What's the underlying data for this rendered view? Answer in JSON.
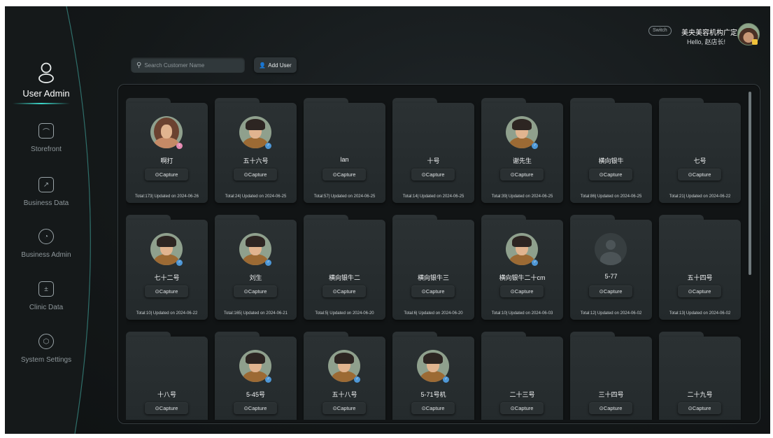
{
  "colors": {
    "background": "#141819",
    "accent": "#3cd6c8",
    "card": "#2b3133"
  },
  "sidebar": {
    "items": [
      {
        "label": "User Admin",
        "icon": "user-icon",
        "active": true
      },
      {
        "label": "Storefront",
        "icon": "storefront-icon",
        "active": false
      },
      {
        "label": "Business Data",
        "icon": "trend-chart-icon",
        "active": false
      },
      {
        "label": "Business Admin",
        "icon": "pie-chart-icon",
        "active": false
      },
      {
        "label": "Clinic Data",
        "icon": "calculator-icon",
        "active": false
      },
      {
        "label": "System Settings",
        "icon": "hexagon-settings-icon",
        "active": false
      }
    ]
  },
  "header": {
    "switch_label": "Switch",
    "store_name": "美央美容机构广定店",
    "greeting": "Hello, 赵店长!"
  },
  "toolbar": {
    "search_placeholder": "Search Customer Name",
    "add_user_label": "Add User"
  },
  "cards": [
    {
      "name": "啊打",
      "avatar": "female",
      "capture_label": "Capture",
      "meta": "Total:173| Updated on 2024-06-26"
    },
    {
      "name": "五十六号",
      "avatar": "male",
      "capture_label": "Capture",
      "meta": "Total:24| Updated on 2024-06-25"
    },
    {
      "name": "lan",
      "avatar": "none",
      "capture_label": "Capture",
      "meta": "Total:57| Updated on 2024-06-25"
    },
    {
      "name": "十号",
      "avatar": "none",
      "capture_label": "Capture",
      "meta": "Total:14| Updated on 2024-06-25"
    },
    {
      "name": "谢先生",
      "avatar": "male",
      "capture_label": "Capture",
      "meta": "Total:39| Updated on 2024-06-25"
    },
    {
      "name": "横向银牛",
      "avatar": "none",
      "capture_label": "Capture",
      "meta": "Total:86| Updated on 2024-06-25"
    },
    {
      "name": "七号",
      "avatar": "none",
      "capture_label": "Capture",
      "meta": "Total:21| Updated on 2024-06-22"
    },
    {
      "name": "七十二号",
      "avatar": "male",
      "capture_label": "Capture",
      "meta": "Total:10| Updated on 2024-06-22"
    },
    {
      "name": "刘生",
      "avatar": "male",
      "capture_label": "Capture",
      "meta": "Total:165| Updated on 2024-06-21"
    },
    {
      "name": "横向银牛二",
      "avatar": "none",
      "capture_label": "Capture",
      "meta": "Total:5| Updated on 2024-06-20"
    },
    {
      "name": "横向银牛三",
      "avatar": "none",
      "capture_label": "Capture",
      "meta": "Total:6| Updated on 2024-06-20"
    },
    {
      "name": "横向银牛二十cm",
      "avatar": "male",
      "capture_label": "Capture",
      "meta": "Total:10| Updated on 2024-06-03"
    },
    {
      "name": "5-77",
      "avatar": "default",
      "capture_label": "Capture",
      "meta": "Total:12| Updated on 2024-06-02"
    },
    {
      "name": "五十四号",
      "avatar": "none",
      "capture_label": "Capture",
      "meta": "Total:13| Updated on 2024-06-02"
    },
    {
      "name": "十八号",
      "avatar": "none",
      "capture_label": "Capture",
      "meta": ""
    },
    {
      "name": "5-45号",
      "avatar": "male",
      "capture_label": "Capture",
      "meta": ""
    },
    {
      "name": "五十八号",
      "avatar": "male",
      "capture_label": "Capture",
      "meta": ""
    },
    {
      "name": "5-71号机",
      "avatar": "male",
      "capture_label": "Capture",
      "meta": ""
    },
    {
      "name": "二十三号",
      "avatar": "none",
      "capture_label": "Capture",
      "meta": ""
    },
    {
      "name": "三十四号",
      "avatar": "none",
      "capture_label": "Capture",
      "meta": ""
    },
    {
      "name": "二十九号",
      "avatar": "none",
      "capture_label": "Capture",
      "meta": ""
    }
  ]
}
